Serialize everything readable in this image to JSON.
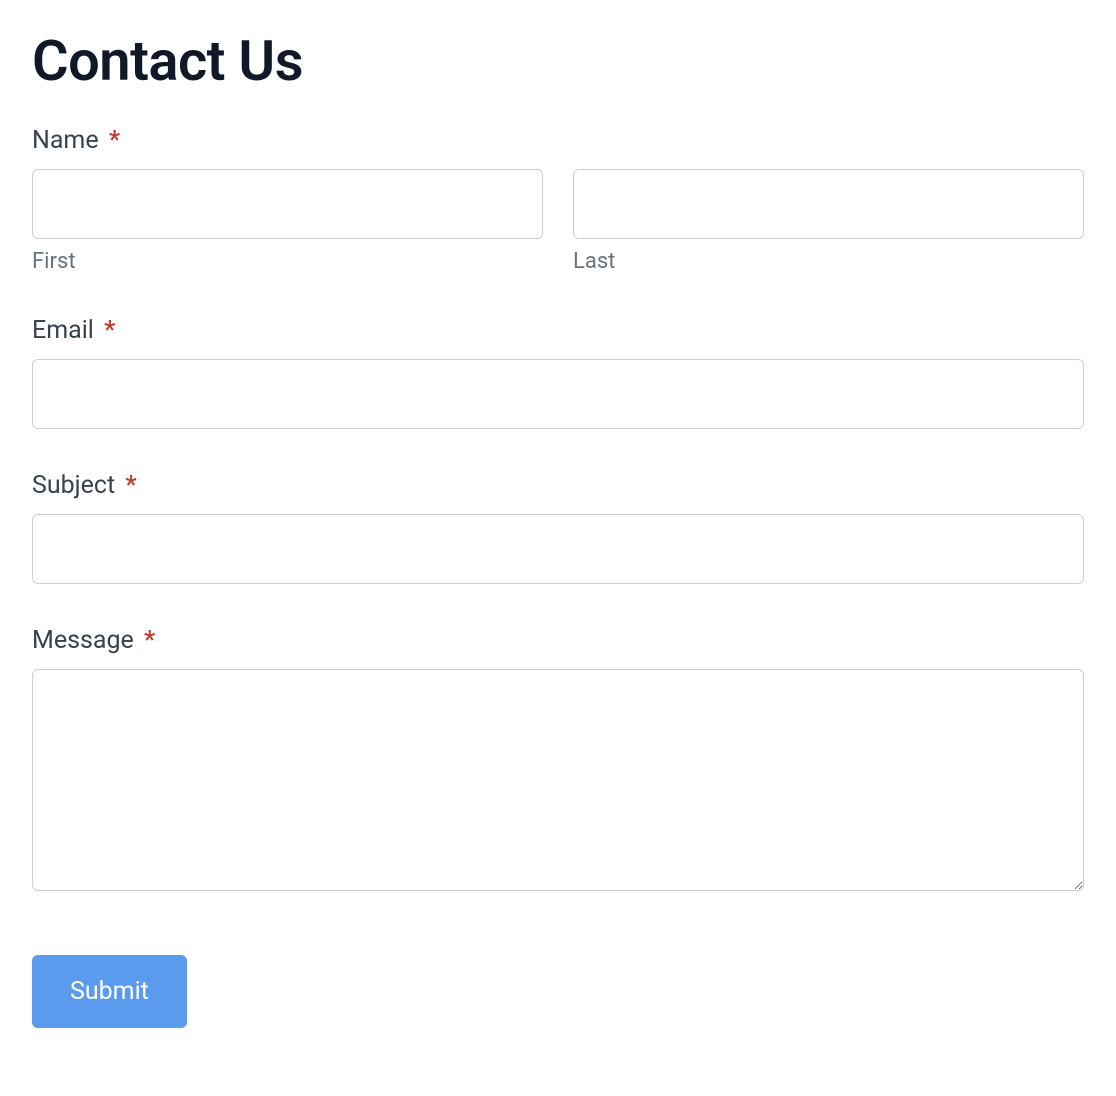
{
  "header": {
    "title": "Contact Us"
  },
  "form": {
    "name": {
      "label": "Name",
      "required_marker": "*",
      "first_sublabel": "First",
      "last_sublabel": "Last",
      "first_value": "",
      "last_value": ""
    },
    "email": {
      "label": "Email",
      "required_marker": "*",
      "value": ""
    },
    "subject": {
      "label": "Subject",
      "required_marker": "*",
      "value": ""
    },
    "message": {
      "label": "Message",
      "required_marker": "*",
      "value": ""
    },
    "submit_label": "Submit"
  }
}
